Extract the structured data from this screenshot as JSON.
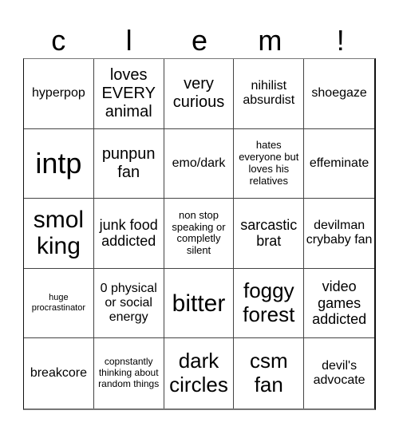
{
  "title": {
    "letters": [
      "c",
      "l",
      "e",
      "m",
      "!"
    ]
  },
  "board": {
    "cells": [
      {
        "text": "hyperpop",
        "size": "s-s"
      },
      {
        "text": "loves EVERY animal",
        "size": "s-m"
      },
      {
        "text": "very curious",
        "size": "s-m"
      },
      {
        "text": "nihilist absurdist",
        "size": "s-s"
      },
      {
        "text": "shoegaze",
        "size": "s-s"
      },
      {
        "text": "intp",
        "size": "s-xxl"
      },
      {
        "text": "punpun fan",
        "size": "s-m"
      },
      {
        "text": "emo/dark",
        "size": "s-s"
      },
      {
        "text": "hates everyone but loves his relatives",
        "size": "s-xxs"
      },
      {
        "text": "effeminate",
        "size": "s-s"
      },
      {
        "text": "smol king",
        "size": "s-xl"
      },
      {
        "text": "junk food addicted",
        "size": "s-ms"
      },
      {
        "text": "non stop speaking or completly silent",
        "size": "s-xxs"
      },
      {
        "text": "sarcastic brat",
        "size": "s-ms"
      },
      {
        "text": "devilman crybaby fan",
        "size": "s-s"
      },
      {
        "text": "huge procrastinator",
        "size": "s-micro"
      },
      {
        "text": "0 physical or social energy",
        "size": "s-s"
      },
      {
        "text": "bitter",
        "size": "s-xl"
      },
      {
        "text": "foggy forest",
        "size": "s-l"
      },
      {
        "text": "video games addicted",
        "size": "s-ms"
      },
      {
        "text": "breakcore",
        "size": "s-s"
      },
      {
        "text": "copnstantly thinking about random things",
        "size": "s-tiny"
      },
      {
        "text": "dark circles",
        "size": "s-l"
      },
      {
        "text": "csm fan",
        "size": "s-l"
      },
      {
        "text": "devil's advocate",
        "size": "s-s"
      }
    ]
  }
}
